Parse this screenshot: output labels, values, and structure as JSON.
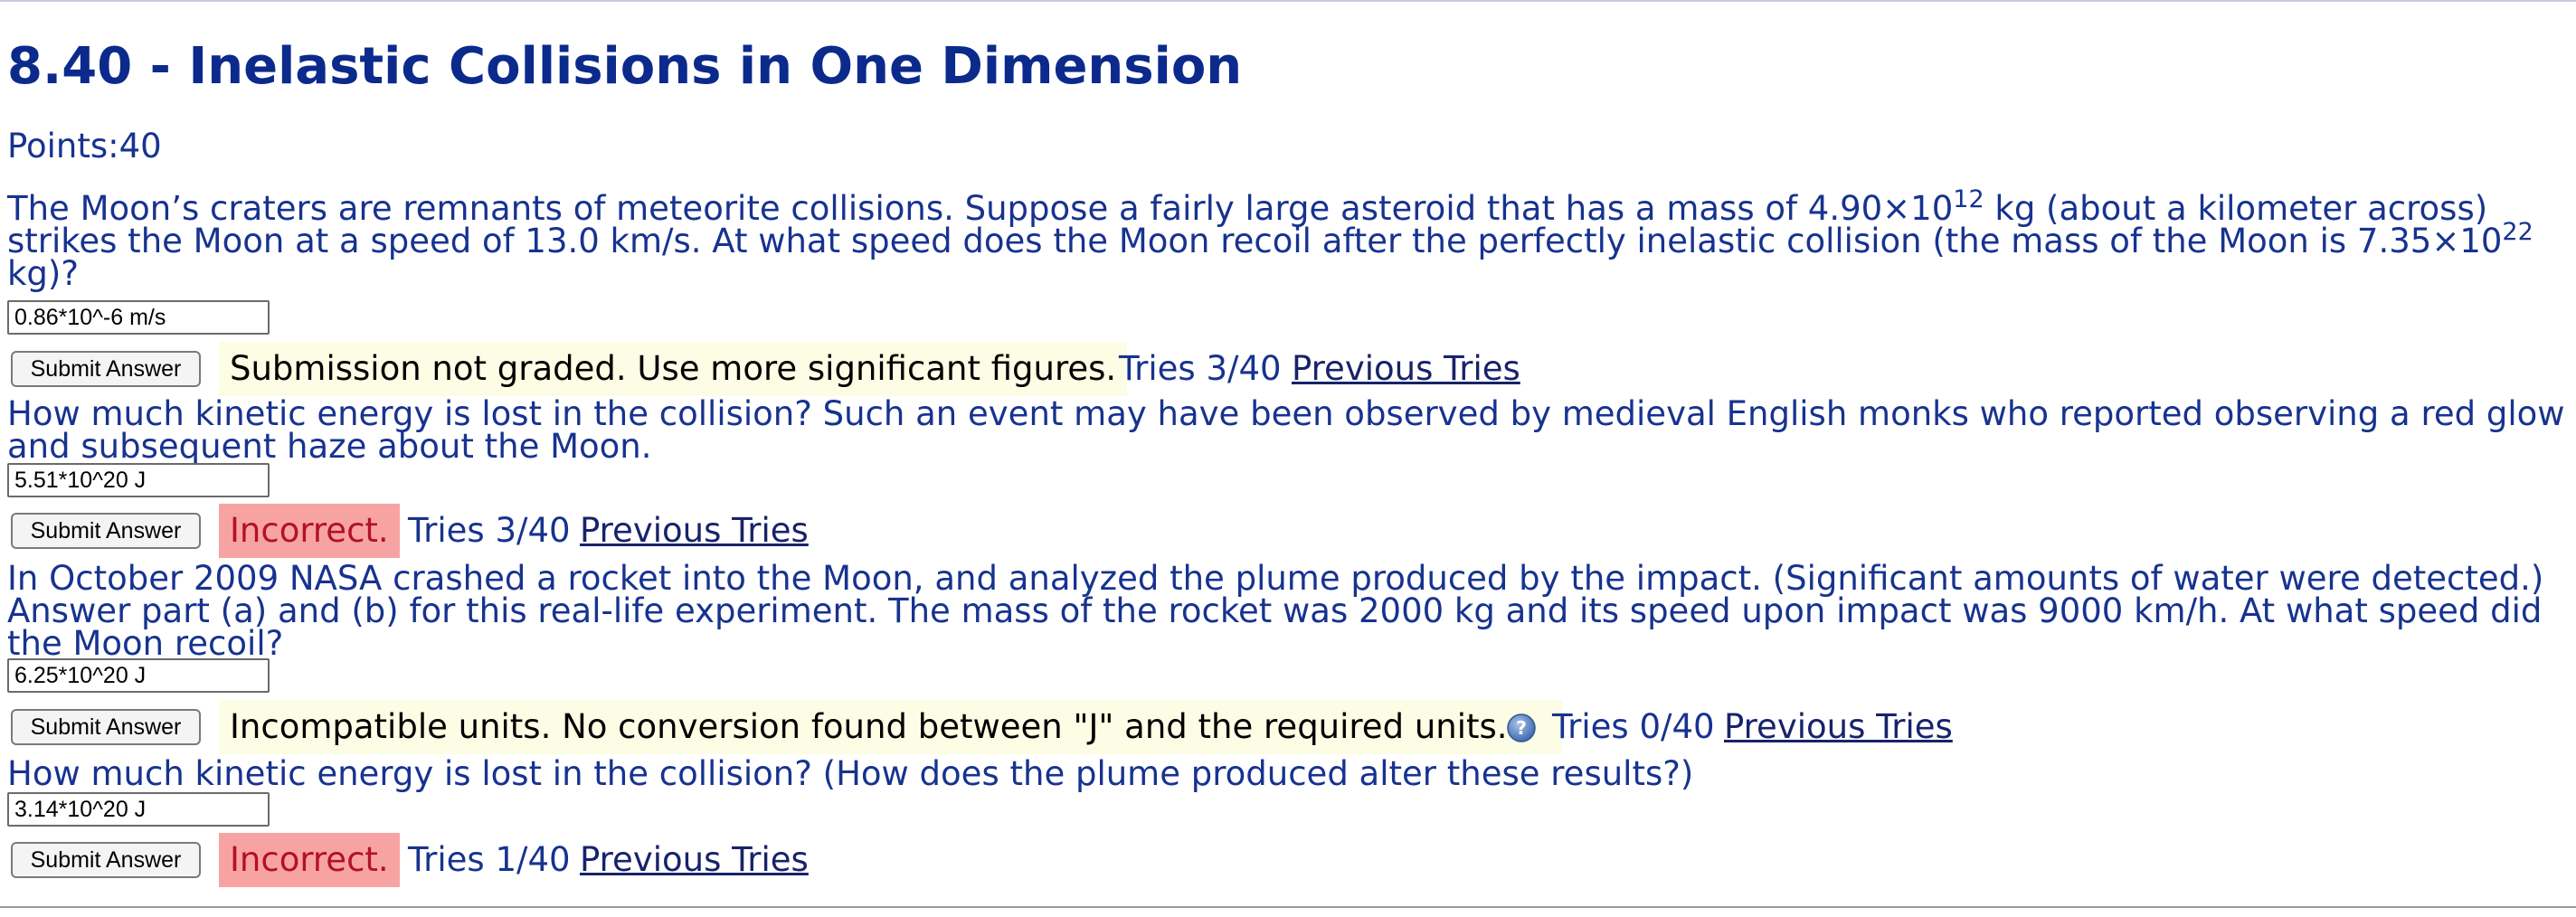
{
  "page": {
    "title": "8.40 - Inelastic Collisions in One Dimension",
    "points_label": "Points:",
    "points_value": "40"
  },
  "parts": [
    {
      "prompt_html": "The Moon’s craters are remnants of meteorite collisions. Suppose a fairly large asteroid that has a mass of 4.90×10<sup>12</sup> kg (about a kilometer across) strikes the Moon at a speed of 13.0 km/s. At what speed does the Moon recoil after the perfectly inelastic collision (the mass of the Moon is 7.35×10<sup>22</sup> kg)?",
      "answer": "0.86*10^-6 m/s",
      "submit_label": "Submit Answer",
      "feedback": "Submission not graded. Use more significant figures.",
      "feedback_style": "yellow",
      "tries": "Tries 3/40",
      "previous_tries_label": "Previous Tries"
    },
    {
      "prompt_html": "How much kinetic energy is lost in the collision? Such an event may have been observed by medieval English monks who reported observing a red glow and subsequent haze about the Moon.",
      "answer": "5.51*10^20 J",
      "submit_label": "Submit Answer",
      "feedback": "Incorrect.",
      "feedback_style": "red",
      "tries": "Tries 3/40",
      "previous_tries_label": "Previous Tries"
    },
    {
      "prompt_html": "In October 2009 NASA crashed a rocket into the Moon, and analyzed the plume produced by the impact. (Significant amounts of water were detected.) Answer part (a) and (b) for this real-life experiment. The mass of the rocket was 2000 kg and its speed upon impact was 9000 km/h. At what speed did the Moon recoil?",
      "answer": "6.25*10^20 J",
      "submit_label": "Submit Answer",
      "feedback": "Incompatible units. No conversion found between \"J\" and the required units.",
      "feedback_style": "yellow",
      "help_icon": "help-icon",
      "tries": "Tries 0/40",
      "previous_tries_label": "Previous Tries"
    },
    {
      "prompt_html": "How much kinetic energy is lost in the collision? (How does the plume produced alter these results?)",
      "answer": "3.14*10^20 J",
      "submit_label": "Submit Answer",
      "feedback": "Incorrect.",
      "feedback_style": "red",
      "tries": "Tries 1/40",
      "previous_tries_label": "Previous Tries"
    }
  ],
  "colors": {
    "title": "#0b2a8c",
    "text": "#17338f",
    "feedback_yellow_bg": "#fdfde5",
    "feedback_red_bg": "#f8a3a3",
    "feedback_red_text": "#b3102a"
  }
}
